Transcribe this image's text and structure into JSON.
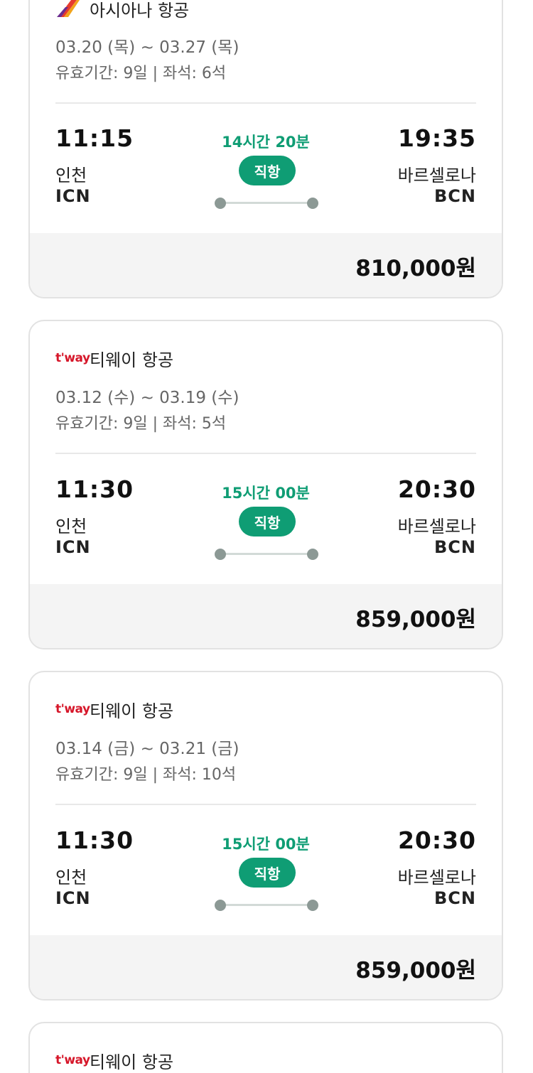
{
  "cards": [
    {
      "airline": "아시아나 항공",
      "logo": "asiana-logo",
      "dates": "03.20 (목) ~ 03.27 (목)",
      "validity": "유효기간: 9일 | 좌석: 6석",
      "dep_time": "11:15",
      "dep_city": "인천",
      "dep_code": "ICN",
      "duration": "14시간 20분",
      "direct": "직항",
      "arr_time": "19:35",
      "arr_city": "바르셀로나",
      "arr_code": "BCN",
      "price": "810,000원"
    },
    {
      "airline": "티웨이 항공",
      "logo": "tway-logo",
      "logo_text": "t'way",
      "dates": "03.12 (수) ~ 03.19 (수)",
      "validity": "유효기간: 9일 | 좌석: 5석",
      "dep_time": "11:30",
      "dep_city": "인천",
      "dep_code": "ICN",
      "duration": "15시간 00분",
      "direct": "직항",
      "arr_time": "20:30",
      "arr_city": "바르셀로나",
      "arr_code": "BCN",
      "price": "859,000원"
    },
    {
      "airline": "티웨이 항공",
      "logo": "tway-logo",
      "logo_text": "t'way",
      "dates": "03.14 (금) ~ 03.21 (금)",
      "validity": "유효기간: 9일 | 좌석: 10석",
      "dep_time": "11:30",
      "dep_city": "인천",
      "dep_code": "ICN",
      "duration": "15시간 00분",
      "direct": "직항",
      "arr_time": "20:30",
      "arr_city": "바르셀로나",
      "arr_code": "BCN",
      "price": "859,000원"
    },
    {
      "airline": "티웨이 항공",
      "logo": "tway-logo",
      "logo_text": "t'way"
    }
  ],
  "colors": {
    "accent_green": "#0f9d74",
    "tway_red": "#d6172a",
    "price_bar_bg": "#f4f4f4"
  }
}
